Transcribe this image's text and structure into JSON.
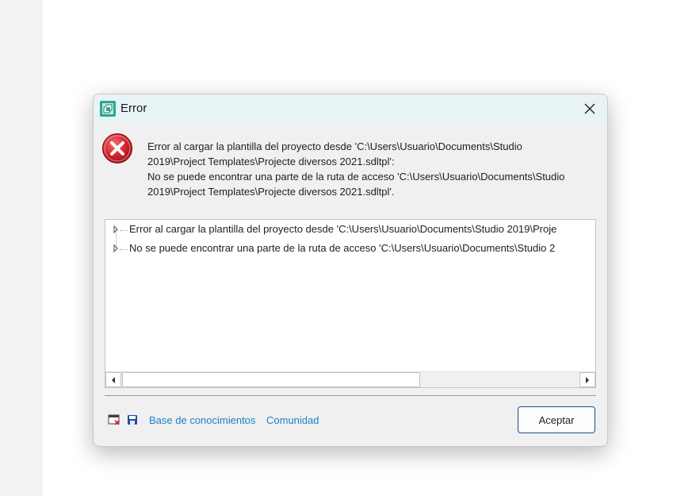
{
  "dialog": {
    "title": "Error",
    "message_lines": [
      "Error al cargar la plantilla del proyecto desde 'C:\\Users\\Usuario\\Documents\\Studio",
      "2019\\Project Templates\\Projecte diversos 2021.sdltpl':",
      "No se puede encontrar una parte de la ruta de acceso 'C:\\Users\\Usuario\\Documents\\Studio",
      "2019\\Project Templates\\Projecte diversos 2021.sdltpl'."
    ],
    "details": [
      {
        "text": "Error al cargar la plantilla del proyecto desde 'C:\\Users\\Usuario\\Documents\\Studio 2019\\Proje"
      },
      {
        "text": "No se puede encontrar una parte de la ruta de acceso 'C:\\Users\\Usuario\\Documents\\Studio 2"
      }
    ],
    "footer": {
      "knowledge_base_link": "Base de conocimientos",
      "community_link": "Comunidad",
      "ok_button": "Aceptar"
    }
  },
  "colors": {
    "titlebar": "#e8f3f6",
    "link": "#1a82c4",
    "error_red": "#c81e1e",
    "button_border": "#1b4f8a"
  },
  "icons": [
    "app-icon",
    "close-icon",
    "error-icon",
    "expand-arrow-icon",
    "scroll-left-icon",
    "scroll-right-icon",
    "copy-to-clipboard-icon",
    "save-icon"
  ]
}
